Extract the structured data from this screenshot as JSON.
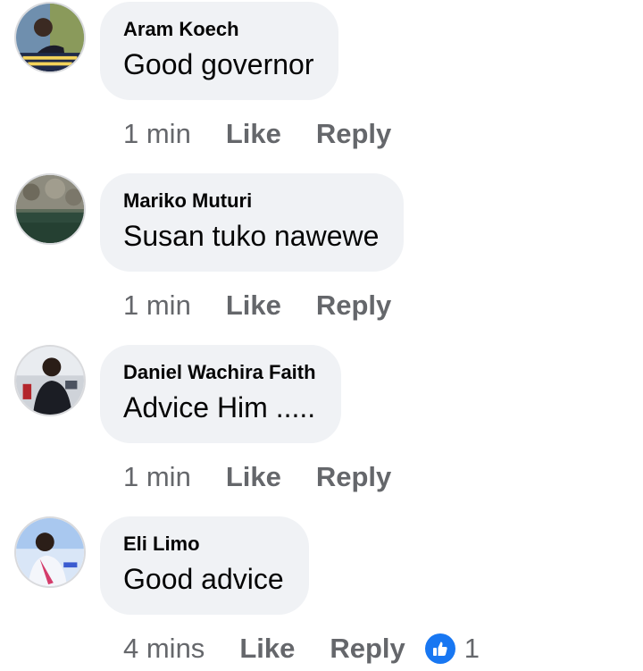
{
  "comments": [
    {
      "author": "Aram Koech",
      "text": "Good governor",
      "time": "1 min",
      "like_label": "Like",
      "reply_label": "Reply"
    },
    {
      "author": "Mariko Muturi",
      "text": "Susan tuko nawewe",
      "time": "1 min",
      "like_label": "Like",
      "reply_label": "Reply"
    },
    {
      "author": "Daniel Wachira Faith",
      "text": "Advice Him .....",
      "time": "1 min",
      "like_label": "Like",
      "reply_label": "Reply"
    },
    {
      "author": "Eli Limo",
      "text": "Good advice",
      "time": "4 mins",
      "like_label": "Like",
      "reply_label": "Reply",
      "reaction": {
        "icon": "thumbs-up-icon",
        "count": "1"
      }
    }
  ],
  "colors": {
    "bubble": "#f0f2f5",
    "meta": "#65676b",
    "text": "#050505",
    "like_blue": "#1877f2"
  }
}
